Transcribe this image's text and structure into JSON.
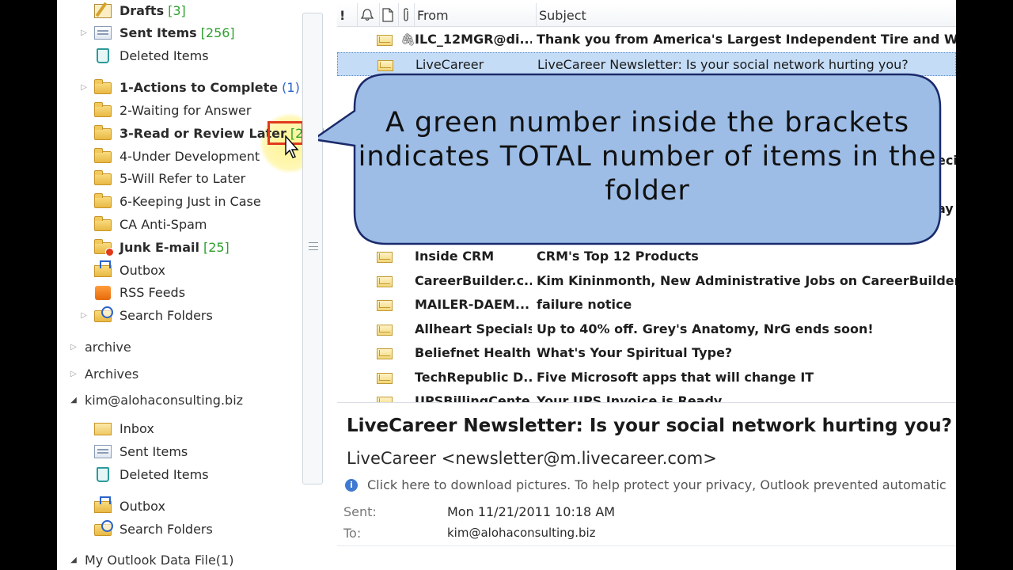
{
  "nav": {
    "folders_top": [
      {
        "label": "Drafts",
        "count": "[3]",
        "icon": "drafts-icon",
        "bold": true
      },
      {
        "label": "Sent Items",
        "count": "[256]",
        "icon": "sent-items-icon",
        "bold": true
      },
      {
        "label": "Deleted Items",
        "count": "",
        "icon": "deleted-items-icon",
        "bold": false
      },
      {
        "label": "1-Actions to Complete",
        "count": "(1)",
        "icon": "folder-icon",
        "bold": true
      },
      {
        "label": "2-Waiting for Answer",
        "count": "",
        "icon": "folder-icon",
        "bold": false
      },
      {
        "label": "3-Read or Review Later",
        "count": "[224]",
        "icon": "folder-icon",
        "bold": true
      },
      {
        "label": "4-Under Development",
        "count": "",
        "icon": "folder-icon",
        "bold": false
      },
      {
        "label": "5-Will Refer to Later",
        "count": "",
        "icon": "folder-icon",
        "bold": false
      },
      {
        "label": "6-Keeping Just in Case",
        "count": "",
        "icon": "folder-icon",
        "bold": false
      },
      {
        "label": "CA Anti-Spam",
        "count": "",
        "icon": "folder-icon",
        "bold": false
      },
      {
        "label": "Junk E-mail",
        "count": "[25]",
        "icon": "junk-email-icon",
        "bold": true
      },
      {
        "label": "Outbox",
        "count": "",
        "icon": "outbox-icon",
        "bold": false
      },
      {
        "label": "RSS Feeds",
        "count": "",
        "icon": "rss-feeds-icon",
        "bold": false
      },
      {
        "label": "Search Folders",
        "count": "",
        "icon": "search-folders-icon",
        "bold": false
      }
    ],
    "archive": "archive",
    "archives": "Archives",
    "account": "kim@alohaconsulting.biz",
    "account_folders": [
      {
        "label": "Inbox",
        "icon": "inbox-icon"
      },
      {
        "label": "Sent Items",
        "icon": "sent-items-icon"
      },
      {
        "label": "Deleted Items",
        "icon": "deleted-items-icon"
      },
      {
        "label": "Outbox",
        "icon": "outbox-icon"
      },
      {
        "label": "Search Folders",
        "icon": "search-folders-icon"
      }
    ],
    "data_file": "My Outlook Data File(1)"
  },
  "list": {
    "headers": {
      "importance": "!",
      "from": "From",
      "subject": "Subject"
    },
    "rows": [
      {
        "from": "ILC_12MGR@di...",
        "subject": "Thank you from America's Largest Independent Tire and Wheel C",
        "attachment": true,
        "selected": false
      },
      {
        "from": "LiveCareer",
        "subject": "LiveCareer Newsletter: Is your social network hurting you?",
        "attachment": false,
        "selected": true
      },
      {
        "from": "",
        "subject": "eci",
        "attachment": false,
        "selected": false
      },
      {
        "from": "",
        "subject": "ay",
        "attachment": false,
        "selected": false
      },
      {
        "from": "Inside CRM",
        "subject": "CRM's Top 12 Products",
        "attachment": false,
        "selected": false
      },
      {
        "from": "CareerBuilder.c...",
        "subject": "Kim Kininmonth, New Administrative Jobs on CareerBuilder.com",
        "attachment": false,
        "selected": false
      },
      {
        "from": "MAILER-DAEM...",
        "subject": "failure notice",
        "attachment": false,
        "selected": false
      },
      {
        "from": "Allheart Specials",
        "subject": "Up to 40% off. Grey's Anatomy, NrG ends soon!",
        "attachment": false,
        "selected": false
      },
      {
        "from": "Beliefnet Health...",
        "subject": "What's Your Spiritual Type?",
        "attachment": false,
        "selected": false
      },
      {
        "from": "TechRepublic D...",
        "subject": "Five Microsoft apps that will change IT",
        "attachment": false,
        "selected": false
      },
      {
        "from": "UPSBillingCente...",
        "subject": "Your UPS Invoice is Ready",
        "attachment": false,
        "selected": false
      }
    ]
  },
  "callout": {
    "text": "A green number inside the brackets indicates TOTAL number of items in the folder"
  },
  "reading": {
    "subject": "LiveCareer Newsletter: Is your social network hurting you?",
    "sender": "LiveCareer <newsletter@m.livecareer.com>",
    "info": "Click here to download pictures. To help protect your privacy, Outlook prevented automatic",
    "sent_label": "Sent:",
    "sent_value": "Mon 11/21/2011 10:18 AM",
    "to_label": "To:",
    "to_value": "kim@alohaconsulting.biz"
  },
  "colors": {
    "accent": "#2ea02e",
    "selection": "#c4dcf6",
    "callout_fill": "#9dbde6"
  }
}
